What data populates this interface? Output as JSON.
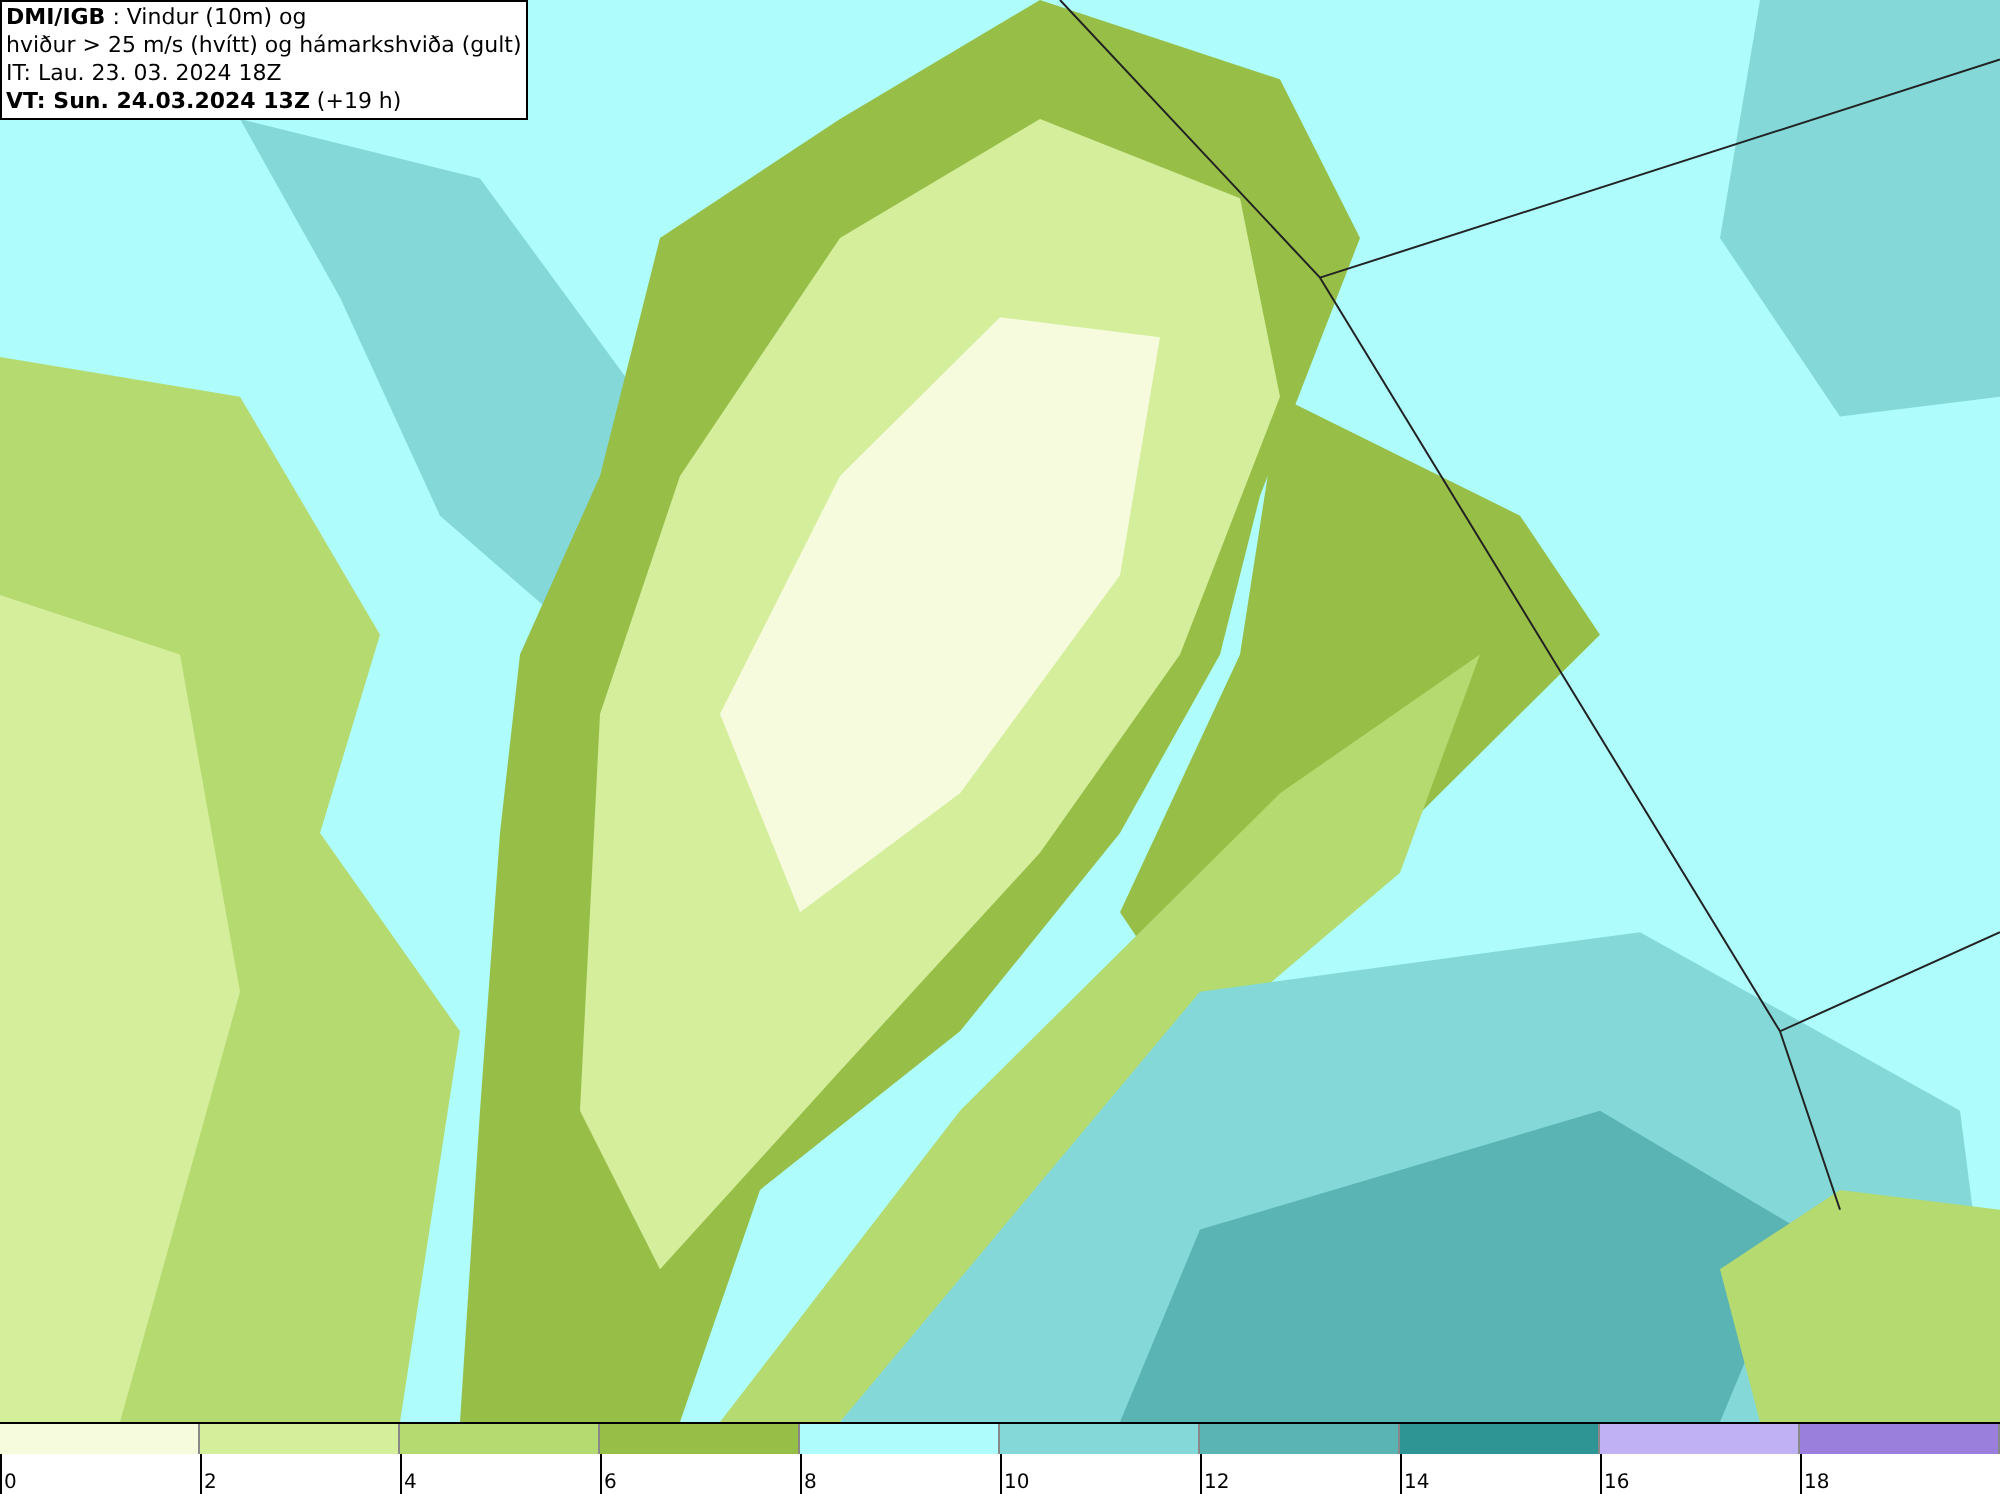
{
  "info_box": {
    "lines": [
      "**DMI/IGB** : Vindur (10m) og",
      "hviður > 25 m/s (hvítt) og hámarkshviða (gult)",
      "IT: Lau. 23. 03. 2024 18Z",
      "**VT: Sun. 24.03.2024 13Z** (+19 h)"
    ]
  },
  "legend": {
    "swatches": [
      {
        "color": "#f5fbdc"
      },
      {
        "color": "#d5ee9c"
      },
      {
        "color": "#b5da70"
      },
      {
        "color": "#97bf48"
      },
      {
        "color": "#aefcfc"
      },
      {
        "color": "#84d8d8"
      },
      {
        "color": "#5ab4b4"
      },
      {
        "color": "#2e9494"
      },
      {
        "color": "#c0b0f4"
      },
      {
        "color": "#9a80dc"
      }
    ],
    "ticks": [
      "0",
      "2",
      "4",
      "6",
      "8",
      "10",
      "12",
      "14",
      "16",
      "18"
    ]
  }
}
